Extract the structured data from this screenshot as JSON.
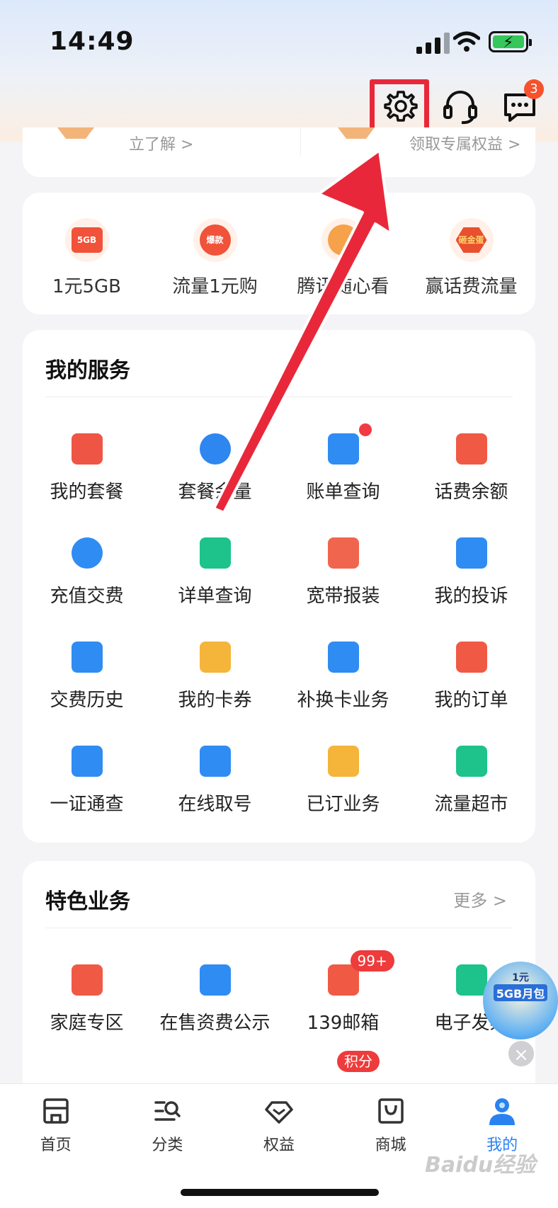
{
  "status": {
    "time": "14:49"
  },
  "header": {
    "message_badge": "3"
  },
  "previous_card": {
    "left_text": "立了解 >",
    "right_text": "领取专属权益 >"
  },
  "promo": {
    "items": [
      {
        "label": "1元5GB",
        "icon": "5GB"
      },
      {
        "label": "流量1元购",
        "icon": "爆款"
      },
      {
        "label": "腾讯随心看",
        "icon": ""
      },
      {
        "label": "赢话费流量",
        "icon": "砸金蛋"
      }
    ]
  },
  "services": {
    "title": "我的服务",
    "items": [
      {
        "label": "我的套餐",
        "icon": "bag-icon",
        "color": "#ef5545"
      },
      {
        "label": "套餐余量",
        "icon": "pie-chart-icon",
        "color": "#2e86f0"
      },
      {
        "label": "账单查询",
        "icon": "bill-icon",
        "color": "#2f8cf2"
      },
      {
        "label": "话费余额",
        "icon": "wallet-icon",
        "color": "#f05a45"
      },
      {
        "label": "充值交费",
        "icon": "recharge-icon",
        "color": "#2f8cf2"
      },
      {
        "label": "详单查询",
        "icon": "list-icon",
        "color": "#1dc38a"
      },
      {
        "label": "宽带报装",
        "icon": "heart-icon",
        "color": "#f0654e"
      },
      {
        "label": "我的投诉",
        "icon": "phone-icon",
        "color": "#2f8cf2"
      },
      {
        "label": "交费历史",
        "icon": "history-icon",
        "color": "#2f8cf2"
      },
      {
        "label": "我的卡券",
        "icon": "coupon-icon",
        "color": "#f5b43a"
      },
      {
        "label": "补换卡业务",
        "icon": "sim-icon",
        "color": "#2f8cf2"
      },
      {
        "label": "我的订单",
        "icon": "order-icon",
        "color": "#f05a45"
      },
      {
        "label": "一证通查",
        "icon": "id-search-icon",
        "color": "#2f8cf2"
      },
      {
        "label": "在线取号",
        "icon": "store-icon",
        "color": "#2f8cf2"
      },
      {
        "label": "已订业务",
        "icon": "briefcase-icon",
        "color": "#f5b43a"
      },
      {
        "label": "流量超市",
        "icon": "gift-icon",
        "color": "#1dc38a"
      }
    ]
  },
  "features": {
    "title": "特色业务",
    "more": "更多 >",
    "items": [
      {
        "label": "家庭专区",
        "icon": "home-heart-icon",
        "color": "#f05a45",
        "badge": ""
      },
      {
        "label": "在售资费公示",
        "icon": "notice-icon",
        "color": "#2f8cf2",
        "badge": ""
      },
      {
        "label": "139邮箱",
        "icon": "mail-icon",
        "color": "#f05a45",
        "badge": "99+"
      },
      {
        "label": "电子发票",
        "icon": "invoice-icon",
        "color": "#1dc38a",
        "badge": ""
      }
    ],
    "row2_badge": "积分"
  },
  "floater": {
    "line1": "1元",
    "line2": "5GB月包"
  },
  "tabs": [
    {
      "label": "首页"
    },
    {
      "label": "分类"
    },
    {
      "label": "权益"
    },
    {
      "label": "商城"
    },
    {
      "label": "我的"
    }
  ],
  "watermark": "Baidu经验"
}
